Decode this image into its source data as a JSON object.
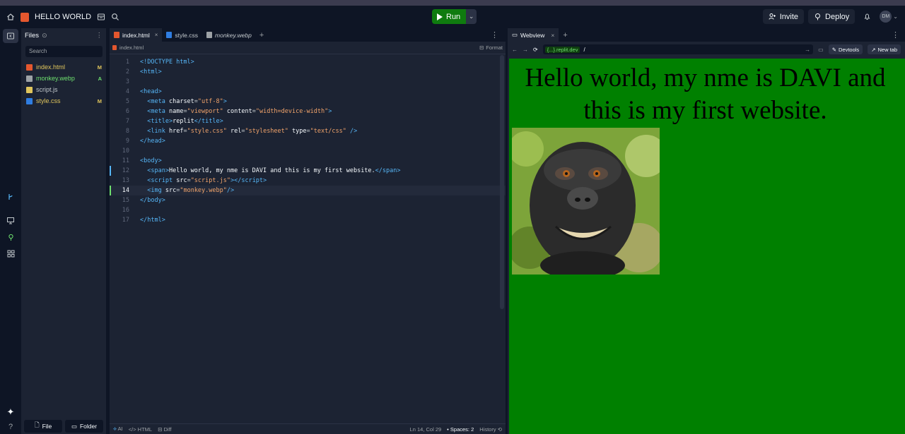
{
  "topbar": {
    "title": "HELLO WORLD",
    "run_label": "Run",
    "invite_label": "Invite",
    "deploy_label": "Deploy",
    "avatar_initials": "DM"
  },
  "files": {
    "header": "Files",
    "search_placeholder": "Search",
    "items": [
      {
        "name": "index.html",
        "badge": "M",
        "color": "#e0c55c",
        "badge_color": "#e0c55c"
      },
      {
        "name": "monkey.webp",
        "badge": "A",
        "color": "#6ee06e",
        "badge_color": "#6ee06e"
      },
      {
        "name": "script.js",
        "badge": "",
        "color": "#c2c8cc",
        "badge_color": ""
      },
      {
        "name": "style.css",
        "badge": "M",
        "color": "#e0c55c",
        "badge_color": "#e0c55c"
      }
    ],
    "new_file_label": "File",
    "new_folder_label": "Folder"
  },
  "editor": {
    "tabs": [
      {
        "label": "index.html",
        "active": true
      },
      {
        "label": "style.css",
        "active": false
      },
      {
        "label": "monkey.webp",
        "active": false
      }
    ],
    "breadcrumb": "index.html",
    "format_label": "Format",
    "current_line": 14,
    "line_numbers": [
      "1",
      "2",
      "3",
      "4",
      "5",
      "6",
      "7",
      "8",
      "9",
      "10",
      "11",
      "12",
      "13",
      "14",
      "15",
      "16",
      "17"
    ],
    "status": {
      "ai": "AI",
      "language": "HTML",
      "diff": "Diff",
      "position": "Ln 14, Col 29",
      "spaces": "Spaces: 2",
      "history": "History"
    }
  },
  "webview": {
    "tab_label": "Webview",
    "url_domain": "{...}.replit.dev",
    "url_path": "/",
    "devtools_label": "Devtools",
    "newtab_label": "New tab",
    "page_text": "Hello world, my nme is DAVI and this is my first website.",
    "page_bg": "#008000"
  }
}
